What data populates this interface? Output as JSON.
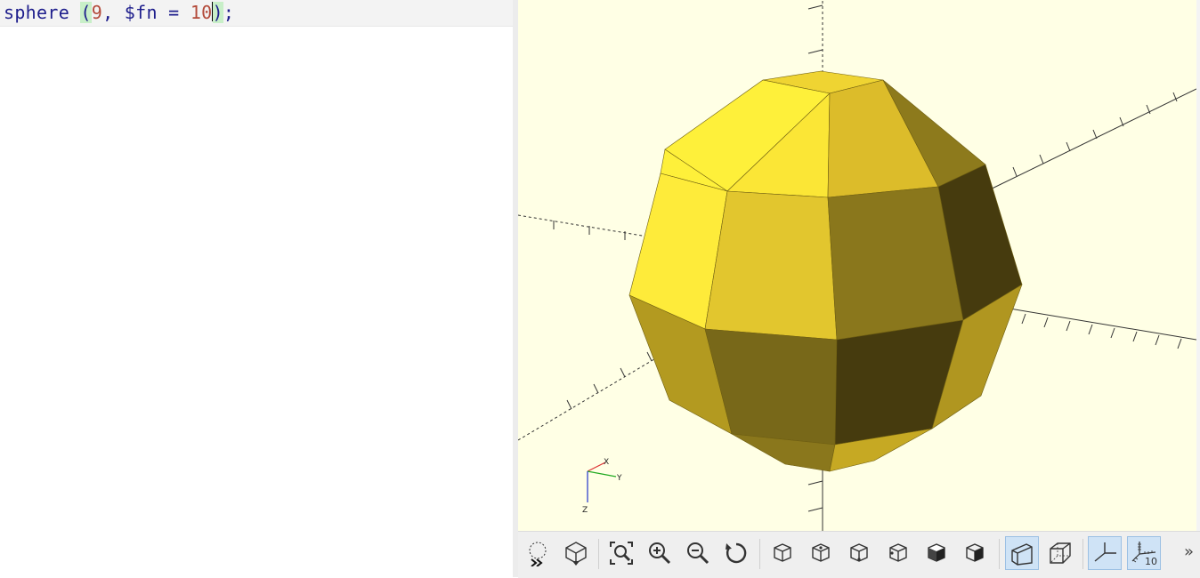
{
  "editor": {
    "tokens": {
      "keyword": "sphere",
      "space": " ",
      "open_paren": "(",
      "radius": "9",
      "comma": ", ",
      "param": "$fn",
      "equals": " = ",
      "fn_value": "10",
      "close_paren": ")",
      "semicolon": ";"
    }
  },
  "viewer": {
    "background": "#ffffe5",
    "face_colors": [
      "#fef03a",
      "#e0c32d",
      "#8a771c",
      "#463b0e",
      "#b0961f"
    ],
    "axis_labels": {
      "x": "X",
      "y": "Y",
      "z": "Z"
    }
  },
  "toolbar": {
    "buttons": [
      {
        "name": "preview-icon",
        "active": false
      },
      {
        "name": "render-icon",
        "active": false
      },
      {
        "name": "view-all-icon",
        "active": false
      },
      {
        "name": "zoom-in-icon",
        "active": false
      },
      {
        "name": "zoom-out-icon",
        "active": false
      },
      {
        "name": "reset-view-icon",
        "active": false
      },
      {
        "name": "view-right-icon",
        "active": false
      },
      {
        "name": "view-top-icon",
        "active": false
      },
      {
        "name": "view-bottom-icon",
        "active": false
      },
      {
        "name": "view-left-icon",
        "active": false
      },
      {
        "name": "view-front-icon",
        "active": false
      },
      {
        "name": "view-back-icon",
        "active": false
      },
      {
        "name": "perspective-icon",
        "active": true
      },
      {
        "name": "orthogonal-icon",
        "active": false
      },
      {
        "name": "show-axes-icon",
        "active": true
      },
      {
        "name": "show-scale-markers-icon",
        "active": true
      }
    ],
    "scale_marker_text": "10",
    "overflow_glyph": "»"
  }
}
